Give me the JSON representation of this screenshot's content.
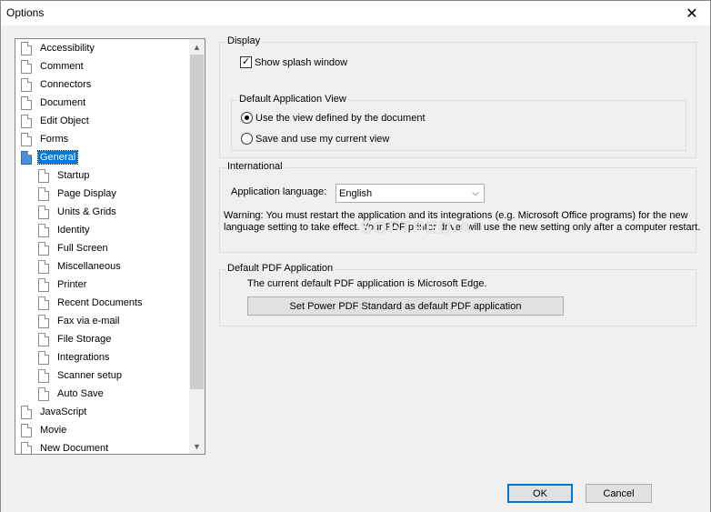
{
  "window": {
    "title": "Options",
    "close_glyph": "✕"
  },
  "tree": {
    "items": [
      {
        "label": "Accessibility",
        "level": 0
      },
      {
        "label": "Comment",
        "level": 0
      },
      {
        "label": "Connectors",
        "level": 0
      },
      {
        "label": "Document",
        "level": 0
      },
      {
        "label": "Edit Object",
        "level": 0
      },
      {
        "label": "Forms",
        "level": 0
      },
      {
        "label": "General",
        "level": 0,
        "selected": true
      },
      {
        "label": "Startup",
        "level": 1
      },
      {
        "label": "Page Display",
        "level": 1
      },
      {
        "label": "Units & Grids",
        "level": 1
      },
      {
        "label": "Identity",
        "level": 1
      },
      {
        "label": "Full Screen",
        "level": 1
      },
      {
        "label": "Miscellaneous",
        "level": 1
      },
      {
        "label": "Printer",
        "level": 1
      },
      {
        "label": "Recent Documents",
        "level": 1
      },
      {
        "label": "Fax via e-mail",
        "level": 1
      },
      {
        "label": "File Storage",
        "level": 1
      },
      {
        "label": "Integrations",
        "level": 1
      },
      {
        "label": "Scanner setup",
        "level": 1
      },
      {
        "label": "Auto Save",
        "level": 1
      },
      {
        "label": "JavaScript",
        "level": 0
      },
      {
        "label": "Movie",
        "level": 0
      },
      {
        "label": "New Document",
        "level": 0
      }
    ]
  },
  "display": {
    "title": "Display",
    "splash_label": "Show splash window",
    "splash_checked": true,
    "default_view": {
      "title": "Default Application View",
      "option_document": "Use the view defined by the document",
      "option_current": "Save and use my current view",
      "selected": "document"
    }
  },
  "international": {
    "title": "International",
    "language_label": "Application language:",
    "language_value": "English",
    "warning": "Warning: You must restart the application and its integrations (e.g. Microsoft Office programs) for the new language setting to take effect. Your PDF printer driver will use the new setting only after a computer restart."
  },
  "default_pdf": {
    "title": "Default PDF Application",
    "current_text": "The current default PDF application is Microsoft Edge.",
    "set_default_label": "Set Power PDF Standard as default PDF application"
  },
  "footer": {
    "ok_label": "OK",
    "cancel_label": "Cancel"
  },
  "watermark": "SOFTPEDIA"
}
